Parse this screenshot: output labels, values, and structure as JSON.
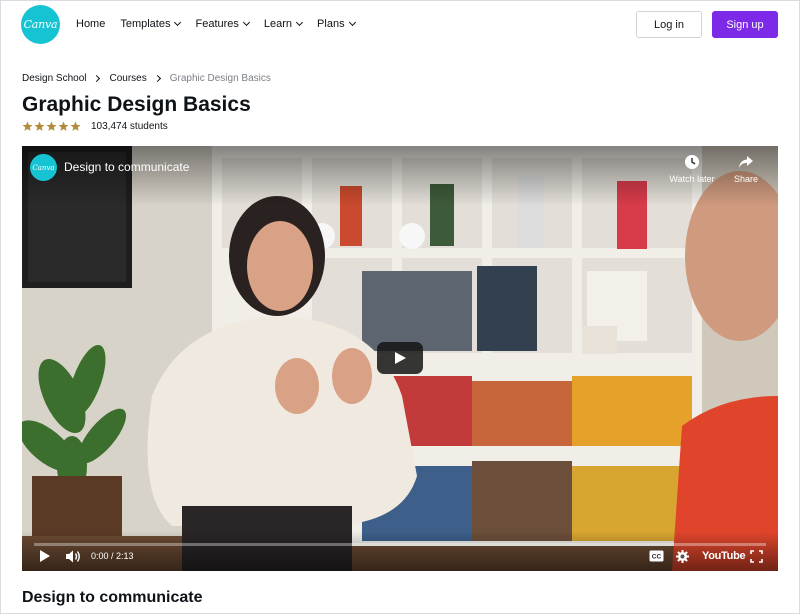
{
  "header": {
    "logo_text": "Canva",
    "nav": [
      {
        "label": "Home",
        "has_dropdown": false
      },
      {
        "label": "Templates",
        "has_dropdown": true
      },
      {
        "label": "Features",
        "has_dropdown": true
      },
      {
        "label": "Learn",
        "has_dropdown": true
      },
      {
        "label": "Plans",
        "has_dropdown": true
      }
    ],
    "login_label": "Log in",
    "signup_label": "Sign up"
  },
  "breadcrumb": {
    "items": [
      "Design School",
      "Courses",
      "Graphic Design Basics"
    ]
  },
  "course": {
    "title": "Graphic Design Basics",
    "rating_stars": 5,
    "students": "103,474 students"
  },
  "video": {
    "channel_icon": "Canva",
    "title": "Design to communicate",
    "watch_later_label": "Watch later",
    "share_label": "Share",
    "time": "0:00 / 2:13",
    "progress": 0,
    "platform": "YouTube"
  },
  "section": {
    "title": "Design to communicate"
  },
  "colors": {
    "brand_teal": "#16c3d3",
    "signup_purple": "#7d2ae8",
    "star_gold": "#b38b3a"
  },
  "icons": [
    "canva-logo-icon",
    "chevron-down-icon",
    "chevron-right-icon",
    "star-icon",
    "clock-icon",
    "share-icon",
    "play-icon",
    "volume-icon",
    "captions-icon",
    "settings-icon",
    "fullscreen-icon"
  ]
}
